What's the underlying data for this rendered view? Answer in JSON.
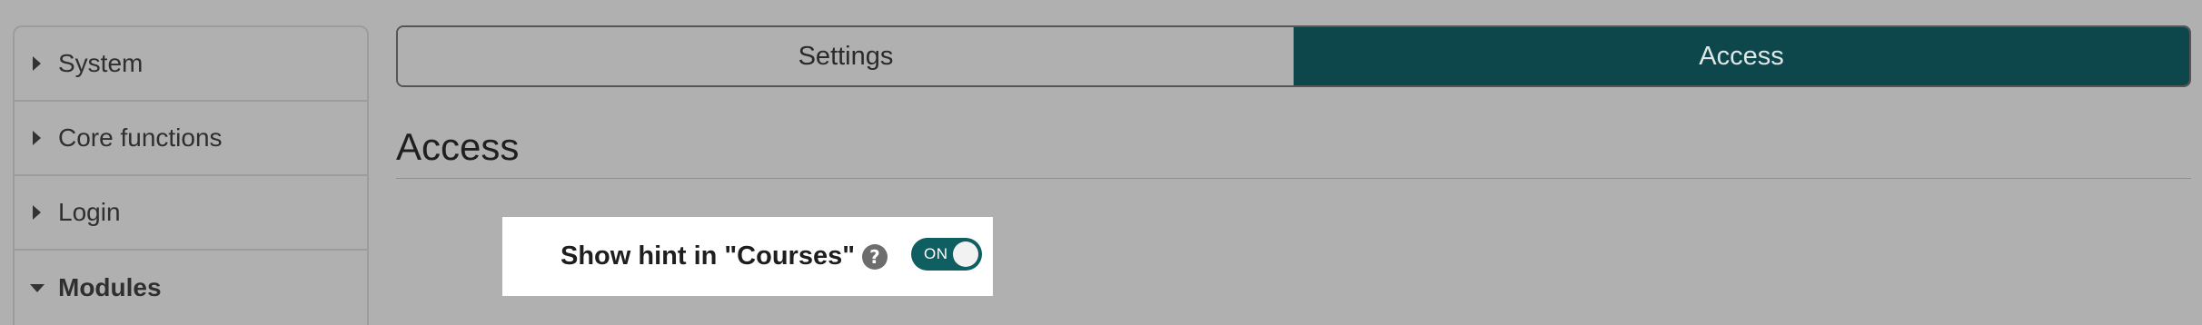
{
  "sidebar": {
    "items": [
      {
        "label": "System",
        "state": "collapsed"
      },
      {
        "label": "Core functions",
        "state": "collapsed"
      },
      {
        "label": "Login",
        "state": "collapsed"
      },
      {
        "label": "Modules",
        "state": "expanded"
      }
    ]
  },
  "tabs": [
    {
      "label": "Settings",
      "active": false
    },
    {
      "label": "Access",
      "active": true
    }
  ],
  "page": {
    "title": "Access"
  },
  "setting": {
    "label": "Show hint in \"Courses\"",
    "help_icon": "?",
    "toggle_label": "ON",
    "toggle_state": true
  },
  "colors": {
    "background": "#b0b0b0",
    "accent": "#0d474b",
    "toggle": "#0f5e62",
    "card": "#ffffff"
  },
  "icons": {
    "collapsed": "caret-right-icon",
    "expanded": "caret-down-icon",
    "help": "help-icon"
  }
}
